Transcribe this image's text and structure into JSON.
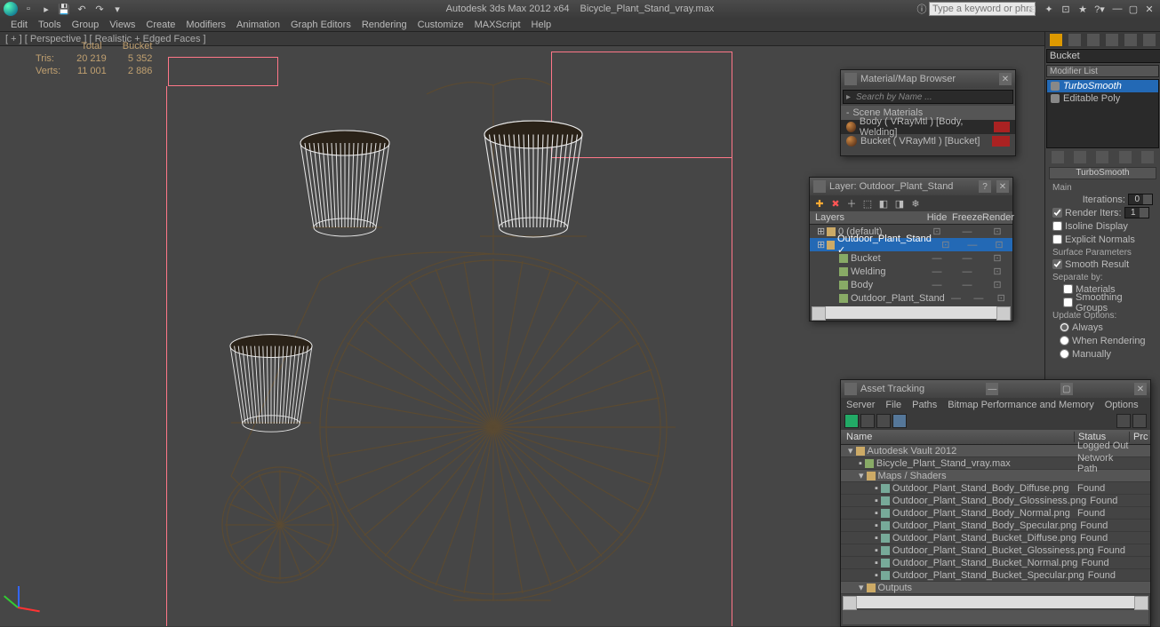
{
  "app": {
    "name": "Autodesk 3ds Max  2012 x64",
    "file": "Bicycle_Plant_Stand_vray.max"
  },
  "search_placeholder": "Type a keyword or phrase",
  "menu": [
    "Edit",
    "Tools",
    "Group",
    "Views",
    "Create",
    "Modifiers",
    "Animation",
    "Graph Editors",
    "Rendering",
    "Customize",
    "MAXScript",
    "Help"
  ],
  "vp_label": "[ + ] [ Perspective ] [ Realistic + Edged Faces ]",
  "stats": {
    "cols": [
      "Total",
      "Bucket"
    ],
    "rows": [
      {
        "label": "Tris:",
        "total": "20 219",
        "bucket": "5 352"
      },
      {
        "label": "Verts:",
        "total": "11 001",
        "bucket": "2 886"
      }
    ]
  },
  "side": {
    "obj_name": "Bucket",
    "mod_list": "Modifier List",
    "stack": [
      {
        "name": "TurboSmooth",
        "sel": true
      },
      {
        "name": "Editable Poly",
        "sel": false
      }
    ],
    "rollout": "TurboSmooth",
    "main": "Main",
    "iterations_lbl": "Iterations:",
    "iterations": "0",
    "render_iters_lbl": "Render Iters:",
    "render_iters": "1",
    "render_iters_chk": true,
    "isoline": "Isoline Display",
    "explicit": "Explicit Normals",
    "surface": "Surface Parameters",
    "smooth_result": "Smooth Result",
    "smooth_result_chk": true,
    "separate": "Separate by:",
    "materials": "Materials",
    "smoothing": "Smoothing Groups",
    "update": "Update Options:",
    "u1": "Always",
    "u2": "When Rendering",
    "u3": "Manually"
  },
  "mat": {
    "title": "Material/Map Browser",
    "search": "Search by Name ...",
    "group": "Scene Materials",
    "items": [
      "Body ( VRayMtl ) [Body, Welding]",
      "Bucket ( VRayMtl ) [Bucket]"
    ]
  },
  "layer": {
    "title": "Layer: Outdoor_Plant_Stand",
    "cols": {
      "name": "Layers",
      "hide": "Hide",
      "freeze": "Freeze",
      "render": "Render"
    },
    "rows": [
      {
        "name": "0 (default)",
        "sel": false,
        "indent": 0,
        "icon": "layer"
      },
      {
        "name": "Outdoor_Plant_Stand",
        "sel": true,
        "indent": 0,
        "icon": "layer",
        "check": true
      },
      {
        "name": "Bucket",
        "sel": false,
        "indent": 1,
        "icon": "obj"
      },
      {
        "name": "Welding",
        "sel": false,
        "indent": 1,
        "icon": "obj"
      },
      {
        "name": "Body",
        "sel": false,
        "indent": 1,
        "icon": "obj"
      },
      {
        "name": "Outdoor_Plant_Stand",
        "sel": false,
        "indent": 1,
        "icon": "obj"
      }
    ]
  },
  "asset": {
    "title": "Asset Tracking",
    "menu": [
      "Server",
      "File",
      "Paths",
      "Bitmap Performance and Memory",
      "Options"
    ],
    "cols": {
      "name": "Name",
      "status": "Status",
      "prc": "Prc"
    },
    "rows": [
      {
        "name": "Autodesk Vault 2012",
        "status": "Logged Out ...",
        "hl": true,
        "indent": 0,
        "icon": "folder"
      },
      {
        "name": "Bicycle_Plant_Stand_vray.max",
        "status": "Network Path",
        "indent": 1,
        "icon": "file"
      },
      {
        "name": "Maps / Shaders",
        "status": "",
        "hl": true,
        "indent": 1,
        "icon": "folder"
      },
      {
        "name": "Outdoor_Plant_Stand_Body_Diffuse.png",
        "status": "Found",
        "indent": 2,
        "icon": "img"
      },
      {
        "name": "Outdoor_Plant_Stand_Body_Glossiness.png",
        "status": "Found",
        "indent": 2,
        "icon": "img"
      },
      {
        "name": "Outdoor_Plant_Stand_Body_Normal.png",
        "status": "Found",
        "indent": 2,
        "icon": "img"
      },
      {
        "name": "Outdoor_Plant_Stand_Body_Specular.png",
        "status": "Found",
        "indent": 2,
        "icon": "img"
      },
      {
        "name": "Outdoor_Plant_Stand_Bucket_Diffuse.png",
        "status": "Found",
        "indent": 2,
        "icon": "img"
      },
      {
        "name": "Outdoor_Plant_Stand_Bucket_Glossiness.png",
        "status": "Found",
        "indent": 2,
        "icon": "img"
      },
      {
        "name": "Outdoor_Plant_Stand_Bucket_Normal.png",
        "status": "Found",
        "indent": 2,
        "icon": "img"
      },
      {
        "name": "Outdoor_Plant_Stand_Bucket_Specular.png",
        "status": "Found",
        "indent": 2,
        "icon": "img"
      },
      {
        "name": "Outputs",
        "status": "",
        "hl": true,
        "indent": 1,
        "icon": "folder"
      }
    ]
  }
}
